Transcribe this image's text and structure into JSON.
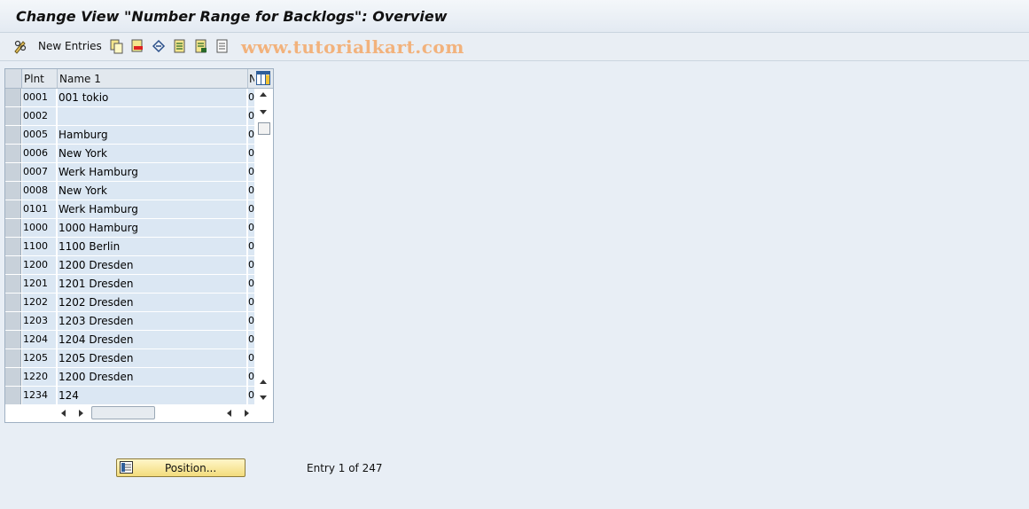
{
  "window": {
    "title": "Change View \"Number Range for Backlogs\": Overview"
  },
  "toolbar": {
    "new_entries_label": "New Entries",
    "icons": [
      "pencil-glasses-icon",
      "copy-icon",
      "delete-icon",
      "undo-icon",
      "select-all-icon",
      "select-block-icon",
      "deselect-all-icon"
    ]
  },
  "watermark": "www.tutorialkart.com",
  "table": {
    "columns": [
      "Plnt",
      "Name 1",
      "N"
    ],
    "rows": [
      {
        "plnt": "0001",
        "name": "001 tokio",
        "n": "0"
      },
      {
        "plnt": "0002",
        "name": "",
        "n": "0"
      },
      {
        "plnt": "0005",
        "name": "Hamburg",
        "n": "0"
      },
      {
        "plnt": "0006",
        "name": "New York",
        "n": "0"
      },
      {
        "plnt": "0007",
        "name": "Werk Hamburg",
        "n": "0"
      },
      {
        "plnt": "0008",
        "name": "New York",
        "n": "0"
      },
      {
        "plnt": "0101",
        "name": "Werk Hamburg",
        "n": "0"
      },
      {
        "plnt": "1000",
        "name": "1000 Hamburg",
        "n": "0"
      },
      {
        "plnt": "1100",
        "name": "1100 Berlin",
        "n": "0"
      },
      {
        "plnt": "1200",
        "name": "1200 Dresden",
        "n": "0"
      },
      {
        "plnt": "1201",
        "name": "1201 Dresden",
        "n": "0"
      },
      {
        "plnt": "1202",
        "name": "1202 Dresden",
        "n": "0"
      },
      {
        "plnt": "1203",
        "name": "1203 Dresden",
        "n": "0"
      },
      {
        "plnt": "1204",
        "name": "1204 Dresden",
        "n": "0"
      },
      {
        "plnt": "1205",
        "name": "1205 Dresden",
        "n": "0"
      },
      {
        "plnt": "1220",
        "name": "1200 Dresden",
        "n": "0"
      },
      {
        "plnt": "1234",
        "name": "124",
        "n": "0"
      }
    ]
  },
  "footer": {
    "position_button": "Position...",
    "entry_info": "Entry 1 of 247"
  }
}
